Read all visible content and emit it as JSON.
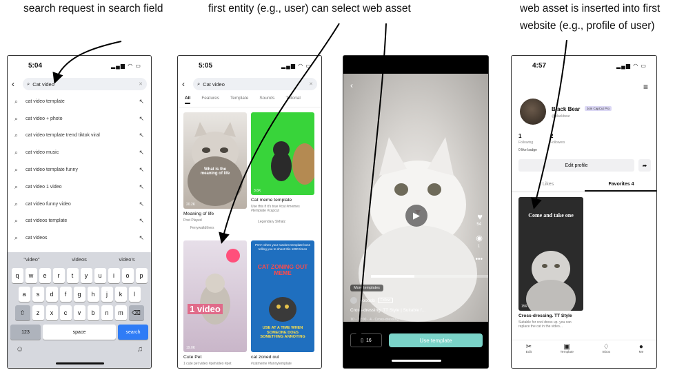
{
  "captions": {
    "c1": "search request in search field",
    "c2": "first entity (e.g., user) can select web asset",
    "c3_line1": "web asset is inserted into first",
    "c3_line2": "website (e.g., profile of user)"
  },
  "phone1": {
    "time": "5:04",
    "query": "Cat video",
    "suggestions": [
      "cat video template",
      "cat video + photo",
      "cat video template trend tiktok viral",
      "cat video music",
      "cat video template funny",
      "cat video 1 video",
      "cat video funny video",
      "cat videos template",
      "cat videos"
    ],
    "predictions": [
      "\"video\"",
      "videos",
      "video's"
    ],
    "row1": [
      "q",
      "w",
      "e",
      "r",
      "t",
      "y",
      "u",
      "i",
      "o",
      "p"
    ],
    "row2": [
      "a",
      "s",
      "d",
      "f",
      "g",
      "h",
      "j",
      "k",
      "l"
    ],
    "row3": [
      "z",
      "x",
      "c",
      "v",
      "b",
      "n",
      "m"
    ],
    "k123": "123",
    "space": "space",
    "search": "search"
  },
  "phone2": {
    "time": "5:05",
    "query": "Cat video",
    "tabs": [
      "All",
      "Features",
      "Template",
      "Sounds",
      "Tutorial"
    ],
    "card1_overlay": "What is the meaning of life",
    "card1_count": "20.2K",
    "card1_title": "Meaning of life",
    "card1_sub": "Post Played",
    "card1_author": "Ferrywaltdthers",
    "card2_count": "3.6K",
    "card2_title": "Cat meme template",
    "card2_sub": "Use this if it's true #cat #memes #template #capcut",
    "card2_author": "Legendary Skhalz",
    "card3_overlay": "1 video",
    "card3_count": "19.0K",
    "card3_title": "Cute Pet",
    "card3_sub": "1 cute pet video #petvideo #pet",
    "card4_top": "POV: when your random template boss telling you to shoot this 1000 times",
    "card4_headline": "CAT ZONING OUT MEME",
    "card4_bottom": "USE AT A TIME WHEN SOMEONE DOES SOMETHING ANNOYING",
    "card4_title": "cat zoned out",
    "card4_sub": "#catmeme #funnytemplate"
  },
  "phone3": {
    "likes": "54",
    "comments": "1",
    "more_templates": "More templates",
    "author": "ooooob",
    "follow": "Follow",
    "desc": "Cross-dressing. TT Style | Suitable f...",
    "stats": "10 · 12:00 · 4 · Cross-dressing",
    "saves": "16",
    "use_template": "Use template"
  },
  "phone4": {
    "time": "4:57",
    "name": "Black Bear",
    "badge": "Join CapCut Pro",
    "handle": "@blackbear",
    "following_n": "1",
    "following_l": "Following",
    "followers_n": "2",
    "followers_l": "Followers",
    "likes_line": "0 like badge",
    "edit": "Edit profile",
    "tab_likes": "Likes",
    "tab_fav": "Favorites 4",
    "tile_caption": "Come and take one",
    "tile_count": "156",
    "tile_title": "Cross-dressing. TT Style",
    "tile_sub": "Suitable for cool dress up. you can replace the cat in the video...",
    "nav": [
      "Edit",
      "Template",
      "Inbox",
      "Me"
    ]
  }
}
